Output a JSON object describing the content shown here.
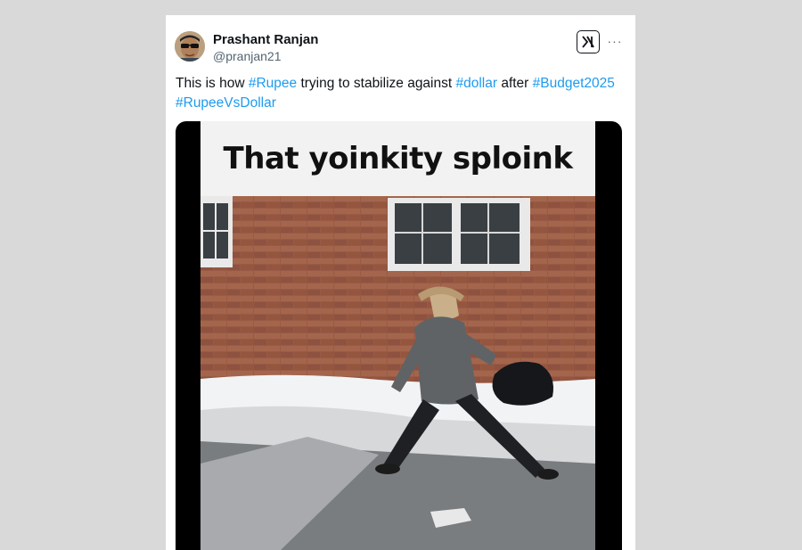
{
  "tweet": {
    "author_name": "Prashant Ranjan",
    "handle": "@pranjan21",
    "text_parts": [
      {
        "text": "This is how ",
        "tag": false
      },
      {
        "text": "#Rupee",
        "tag": true
      },
      {
        "text": " trying to stabilize against ",
        "tag": false
      },
      {
        "text": "#dollar",
        "tag": true
      },
      {
        "text": " after ",
        "tag": false
      },
      {
        "text": "#Budget2025",
        "tag": true
      },
      {
        "text": " ",
        "tag": false
      },
      {
        "text": "#RupeeVsDollar",
        "tag": true
      }
    ],
    "media_caption": "That yoinkity sploink",
    "more_label": "···"
  },
  "icons": {
    "platform_logo": "x-logo-icon",
    "more": "more-options-icon"
  },
  "colors": {
    "hashtag": "#1d9bf0",
    "text": "#0f1419",
    "secondary": "#536471",
    "background": "#d9d9d9",
    "card": "#ffffff"
  }
}
